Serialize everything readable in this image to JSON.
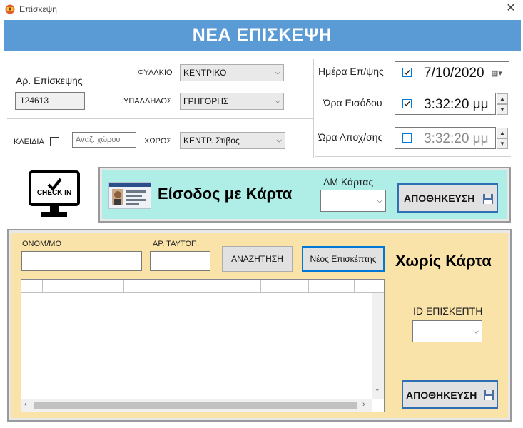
{
  "window": {
    "title": "Επίσκεψη",
    "close_glyph": "✕"
  },
  "header": {
    "title": "ΝΕΑ ΕΠΙΣΚΕΨΗ",
    "bg_color": "#5b9bd5"
  },
  "visit": {
    "number_label": "Αρ. Επίσκεψης",
    "number_value": "124613",
    "prison_label": "ΦΥΛΑΚΙΟ",
    "prison_value": "ΚΕΝΤΡΙΚΟ",
    "employee_label": "ΥΠΑΛΛΗΛΟΣ",
    "employee_value": "ΓΡΗΓΟΡΗΣ",
    "keys_label": "ΚΛΕΙΔΙΑ",
    "keys_checked": false,
    "space_search_placeholder": "Αναζ. χώρου",
    "space_label": "ΧΩΡΟΣ",
    "space_value": "ΚΕΝΤΡ. Στίβος"
  },
  "datetime": {
    "day_label": "Ημέρα Επ/ψης",
    "day_value": "7/10/2020",
    "entry_label": "Ώρα Εισόδου",
    "entry_value": "3:32:20 μμ",
    "exit_label": "Ώρα Αποχ/σης",
    "exit_value": "3:32:20 μμ"
  },
  "card_panel": {
    "checkin_icon_text": "CHECK IN",
    "title": "Είσοδος με Κάρτα",
    "card_am_label": "ΑΜ Κάρτας",
    "card_am_value": "",
    "save_label": "ΑΠΟΘΗΚΕΥΣΗ",
    "bg_color": "#aeeee6"
  },
  "no_card_panel": {
    "name_label": "ΟΝΟΜ/ΜΟ",
    "name_value": "",
    "id_label": "ΑΡ. ΤΑΥΤΟΠ.",
    "id_value": "",
    "search_label": "ΑΝΑΖΗΤΗΣΗ",
    "new_visitor_label": "Νέος Επισκέπτης",
    "title": "Χωρίς Κάρτα",
    "visitor_id_label": "ID ΕΠΙΣΚΕΠΤΗ",
    "visitor_id_value": "",
    "save_label": "ΑΠΟΘΗΚΕΥΣΗ",
    "bg_color": "#fae3a8"
  }
}
